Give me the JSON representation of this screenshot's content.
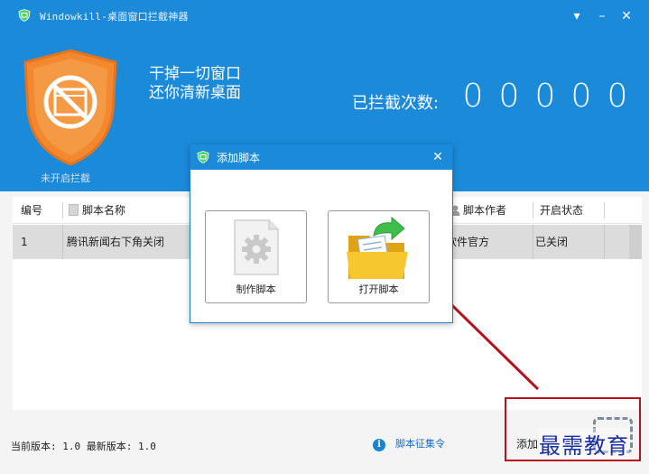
{
  "app": {
    "title": "Windowkill-桌面窗口拦截神器",
    "window_controls": {
      "menu": "▾",
      "minimize": "–",
      "close": "✕"
    }
  },
  "shield": {
    "status": "未开启拦截",
    "icon": "forbidden-window-shield-icon",
    "color": "#f3882f"
  },
  "slogan": {
    "line1": "干掉一切窗口",
    "line2": "还你清新桌面"
  },
  "counter": {
    "label": "已拦截次数:",
    "digits": [
      "0",
      "0",
      "0",
      "0",
      "0"
    ]
  },
  "table": {
    "headers": {
      "id": "编号",
      "name": "脚本名称",
      "author": "脚本作者",
      "status": "开启状态"
    },
    "rows": [
      {
        "id": "1",
        "name": "腾讯新闻右下角关闭",
        "author": "软件官方",
        "status": "已关闭"
      }
    ]
  },
  "dialog": {
    "title": "添加脚本",
    "close": "✕",
    "options": [
      {
        "label": "制作脚本",
        "icon": "gear-document-icon"
      },
      {
        "label": "打开脚本",
        "icon": "open-folder-icon"
      }
    ]
  },
  "footer": {
    "version": "当前版本: 1.0 最新版本: 1.0",
    "collect_link": "脚本征集令",
    "add_label": "添加",
    "watermark": "最需教育"
  },
  "colors": {
    "brand": "#1b8ad8",
    "annotation": "#b5121b",
    "watermark": "#1a2ea6"
  }
}
